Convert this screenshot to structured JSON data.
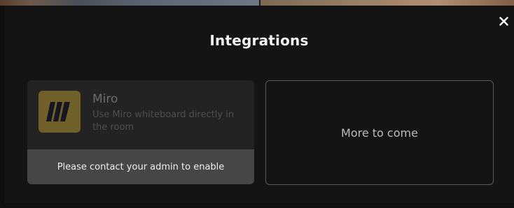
{
  "modal": {
    "title": "Integrations",
    "close_icon": "close-icon"
  },
  "integrations": [
    {
      "name": "Miro",
      "description": "Use Miro whiteboard directly in the room",
      "icon": "miro-logo-icon",
      "action_text": "Please contact your admin to enable",
      "enabled": false
    }
  ],
  "placeholder": {
    "label": "More to come"
  },
  "colors": {
    "background": "#141414",
    "card_disabled": "#232323",
    "footer": "#464646",
    "miro_logo": "#70602a"
  }
}
